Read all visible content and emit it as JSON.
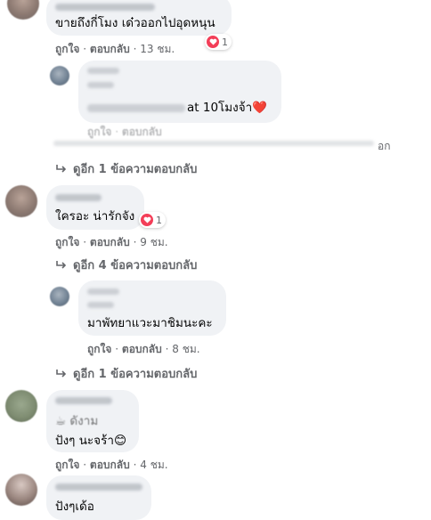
{
  "comments": [
    {
      "text": "ขายถึงกี่โมง เด๋วออกไปอุดหนุน",
      "reaction_count": "1",
      "like": "ถูกใจ",
      "reply": "ตอบกลับ",
      "time": "13 ชม."
    },
    {
      "text_tail": "at 10โมงจ้า",
      "emoji": "❤️",
      "like": "ถูกใจ",
      "reply": "ตอบกลับ"
    },
    {
      "more_replies": "ดูอีก 1 ข้อความตอบกลับ"
    },
    {
      "text": "ใครอะ น่ารักจัง",
      "reaction_count": "1",
      "like": "ถูกใจ",
      "reply": "ตอบกลับ",
      "time": "9 ชม.",
      "more_replies": "ดูอีก 4 ข้อความตอบกลับ"
    },
    {
      "text": "มาพัทยาแวะมาชิมนะคะ",
      "like": "ถูกใจ",
      "reply": "ตอบกลับ",
      "time": "8 ชม.",
      "more_replies": "ดูอีก 1 ข้อความตอบกลับ"
    },
    {
      "line1": "☕ ดังาม",
      "line2": "ปังๆ นะจร้า",
      "emoji": "😊",
      "like": "ถูกใจ",
      "reply": "ตอบกลับ",
      "time": "4 ชม."
    },
    {
      "text": "ปังๆเด้อ"
    }
  ],
  "sep": "·",
  "faded_text_tail": "อก"
}
